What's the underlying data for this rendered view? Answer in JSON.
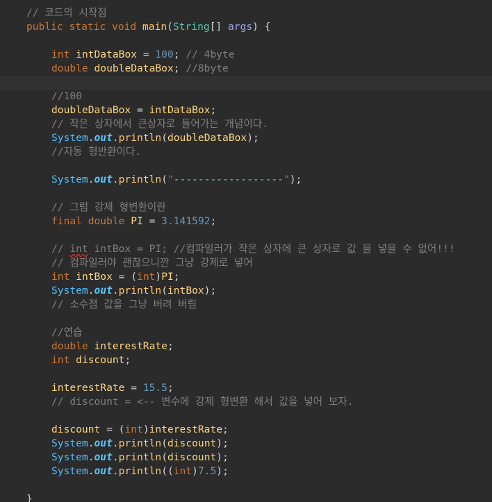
{
  "editor": {
    "lines": [
      {
        "tokens": [
          {
            "t": "// 코드의 시작점",
            "c": "comment"
          }
        ]
      },
      {
        "tokens": [
          {
            "t": "public ",
            "c": "kw"
          },
          {
            "t": "static ",
            "c": "kw"
          },
          {
            "t": "void ",
            "c": "kw"
          },
          {
            "t": "main",
            "c": "method"
          },
          {
            "t": "(",
            "c": "plain"
          },
          {
            "t": "String",
            "c": "type"
          },
          {
            "t": "[] ",
            "c": "plain"
          },
          {
            "t": "args",
            "c": "param"
          },
          {
            "t": ") {",
            "c": "plain"
          }
        ]
      },
      {
        "tokens": []
      },
      {
        "tokens": [
          {
            "t": "int ",
            "c": "kw"
          },
          {
            "t": "intDataBox",
            "c": "var"
          },
          {
            "t": " = ",
            "c": "plain"
          },
          {
            "t": "100",
            "c": "num"
          },
          {
            "t": "; ",
            "c": "plain"
          },
          {
            "t": "// 4byte",
            "c": "comment"
          }
        ]
      },
      {
        "tokens": [
          {
            "t": "double ",
            "c": "kw"
          },
          {
            "t": "doubleDataBox",
            "c": "var"
          },
          {
            "t": "; ",
            "c": "plain"
          },
          {
            "t": "//8byte",
            "c": "comment"
          }
        ]
      },
      {
        "tokens": []
      },
      {
        "tokens": [
          {
            "t": "//100",
            "c": "comment"
          }
        ]
      },
      {
        "tokens": [
          {
            "t": "doubleDataBox",
            "c": "var"
          },
          {
            "t": " = ",
            "c": "plain"
          },
          {
            "t": "intDataBox",
            "c": "var"
          },
          {
            "t": ";",
            "c": "plain"
          }
        ]
      },
      {
        "tokens": [
          {
            "t": "// 작은 상자에서 큰상자로 들어가는 개념이다.",
            "c": "comment"
          }
        ]
      },
      {
        "tokens": [
          {
            "t": "System",
            "c": "sys"
          },
          {
            "t": ".",
            "c": "plain"
          },
          {
            "t": "out",
            "c": "field"
          },
          {
            "t": ".",
            "c": "plain"
          },
          {
            "t": "println",
            "c": "method"
          },
          {
            "t": "(",
            "c": "plain"
          },
          {
            "t": "doubleDataBox",
            "c": "var"
          },
          {
            "t": ");",
            "c": "plain"
          }
        ]
      },
      {
        "tokens": [
          {
            "t": "//자동 형반환이다.",
            "c": "comment"
          }
        ]
      },
      {
        "tokens": []
      },
      {
        "tokens": [
          {
            "t": "System",
            "c": "sys"
          },
          {
            "t": ".",
            "c": "plain"
          },
          {
            "t": "out",
            "c": "field"
          },
          {
            "t": ".",
            "c": "plain"
          },
          {
            "t": "println",
            "c": "method"
          },
          {
            "t": "(",
            "c": "plain"
          },
          {
            "t": "\"",
            "c": "str"
          },
          {
            "t": "------------------",
            "c": "str-inner"
          },
          {
            "t": "\"",
            "c": "str"
          },
          {
            "t": ");",
            "c": "plain"
          }
        ]
      },
      {
        "tokens": []
      },
      {
        "tokens": [
          {
            "t": "// 그럼 강제 형변환이란",
            "c": "comment"
          }
        ]
      },
      {
        "tokens": [
          {
            "t": "final ",
            "c": "kw"
          },
          {
            "t": "double ",
            "c": "kw"
          },
          {
            "t": "PI",
            "c": "var"
          },
          {
            "t": " = ",
            "c": "plain"
          },
          {
            "t": "3.141592",
            "c": "num"
          },
          {
            "t": ";",
            "c": "plain"
          }
        ]
      },
      {
        "tokens": []
      },
      {
        "tokens": [
          {
            "t": "// ",
            "c": "comment"
          },
          {
            "t": "int",
            "c": "comment warn"
          },
          {
            "t": " intBox = PI; //컴파일러가 작은 상자에 큰 상자로 값 을 넣을 수 없어!!!",
            "c": "comment"
          }
        ]
      },
      {
        "tokens": [
          {
            "t": "// 컴파일러야 괜찮으니깐 그냥 강제로 넣어",
            "c": "comment"
          }
        ]
      },
      {
        "tokens": [
          {
            "t": "int ",
            "c": "kw"
          },
          {
            "t": "intBox",
            "c": "var"
          },
          {
            "t": " = (",
            "c": "plain"
          },
          {
            "t": "int",
            "c": "kw"
          },
          {
            "t": ")",
            "c": "plain"
          },
          {
            "t": "PI",
            "c": "var"
          },
          {
            "t": ";",
            "c": "plain"
          }
        ]
      },
      {
        "tokens": [
          {
            "t": "System",
            "c": "sys"
          },
          {
            "t": ".",
            "c": "plain"
          },
          {
            "t": "out",
            "c": "field"
          },
          {
            "t": ".",
            "c": "plain"
          },
          {
            "t": "println",
            "c": "method"
          },
          {
            "t": "(",
            "c": "plain"
          },
          {
            "t": "intBox",
            "c": "var"
          },
          {
            "t": ");",
            "c": "plain"
          }
        ]
      },
      {
        "tokens": [
          {
            "t": "// 소수점 값을 그냥 버려 버림",
            "c": "comment"
          }
        ]
      },
      {
        "tokens": []
      },
      {
        "tokens": [
          {
            "t": "//연습",
            "c": "comment"
          }
        ]
      },
      {
        "tokens": [
          {
            "t": "double ",
            "c": "kw"
          },
          {
            "t": "interestRate",
            "c": "var"
          },
          {
            "t": ";",
            "c": "plain"
          }
        ]
      },
      {
        "tokens": [
          {
            "t": "int ",
            "c": "kw"
          },
          {
            "t": "discount",
            "c": "var"
          },
          {
            "t": ";",
            "c": "plain"
          }
        ]
      },
      {
        "tokens": []
      },
      {
        "tokens": [
          {
            "t": "interestRate",
            "c": "var"
          },
          {
            "t": " = ",
            "c": "plain"
          },
          {
            "t": "15.5",
            "c": "num"
          },
          {
            "t": ";",
            "c": "plain"
          }
        ]
      },
      {
        "tokens": [
          {
            "t": "// discount = <-- 변수에 강제 형변환 해서 값을 넣어 보자.",
            "c": "comment"
          }
        ]
      },
      {
        "tokens": []
      },
      {
        "tokens": [
          {
            "t": "discount",
            "c": "var"
          },
          {
            "t": " = (",
            "c": "plain"
          },
          {
            "t": "int",
            "c": "kw"
          },
          {
            "t": ")",
            "c": "plain"
          },
          {
            "t": "interestRate",
            "c": "var"
          },
          {
            "t": ";",
            "c": "plain"
          }
        ]
      },
      {
        "tokens": [
          {
            "t": "System",
            "c": "sys"
          },
          {
            "t": ".",
            "c": "plain"
          },
          {
            "t": "out",
            "c": "field"
          },
          {
            "t": ".",
            "c": "plain"
          },
          {
            "t": "println",
            "c": "method"
          },
          {
            "t": "(",
            "c": "plain"
          },
          {
            "t": "discount",
            "c": "var"
          },
          {
            "t": ");",
            "c": "plain"
          }
        ]
      },
      {
        "tokens": [
          {
            "t": "System",
            "c": "sys"
          },
          {
            "t": ".",
            "c": "plain"
          },
          {
            "t": "out",
            "c": "field"
          },
          {
            "t": ".",
            "c": "plain"
          },
          {
            "t": "println",
            "c": "method"
          },
          {
            "t": "(",
            "c": "plain"
          },
          {
            "t": "discount",
            "c": "var"
          },
          {
            "t": ");",
            "c": "plain"
          }
        ]
      },
      {
        "tokens": [
          {
            "t": "System",
            "c": "sys"
          },
          {
            "t": ".",
            "c": "plain"
          },
          {
            "t": "out",
            "c": "field"
          },
          {
            "t": ".",
            "c": "plain"
          },
          {
            "t": "println",
            "c": "method"
          },
          {
            "t": "((",
            "c": "plain"
          },
          {
            "t": "int",
            "c": "kw"
          },
          {
            "t": ")",
            "c": "plain"
          },
          {
            "t": "7.5",
            "c": "num"
          },
          {
            "t": ");",
            "c": "plain"
          }
        ]
      },
      {
        "tokens": []
      },
      {
        "tokens": [
          {
            "t": "}",
            "c": "plain"
          }
        ]
      }
    ]
  }
}
